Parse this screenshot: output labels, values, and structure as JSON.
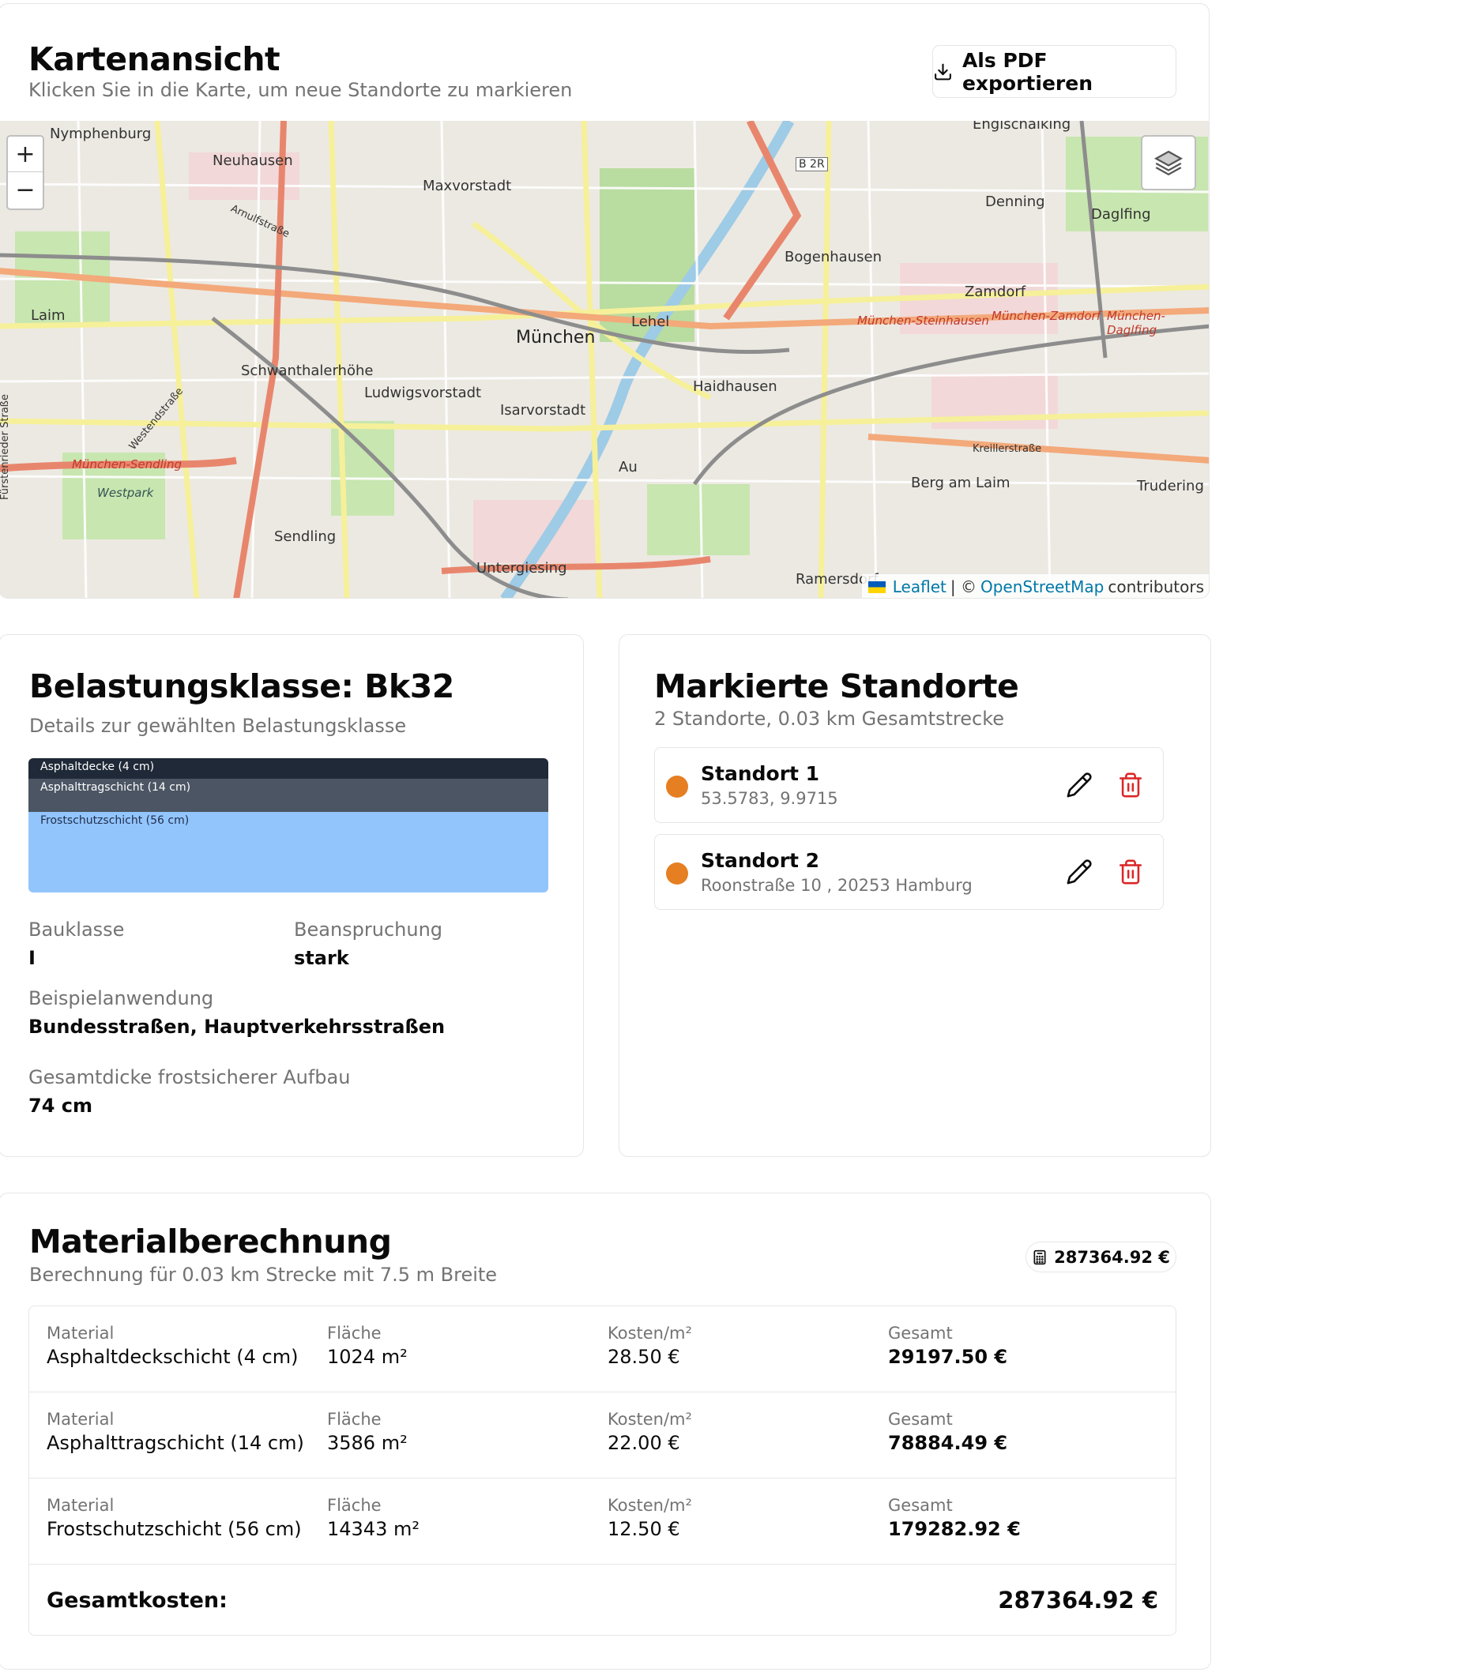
{
  "map_card": {
    "title": "Kartenansicht",
    "subtitle": "Klicken Sie in die Karte, um neue Standorte zu markieren",
    "export_button": "Als PDF exportieren",
    "zoom_in": "+",
    "zoom_out": "−",
    "attribution": {
      "leaflet": "Leaflet",
      "separator": "| ©",
      "osm": "OpenStreetMap",
      "suffix": "contributors"
    },
    "labels": [
      "Nymphenburg",
      "Neuhausen",
      "Maxvorstadt",
      "Englschalking",
      "B 2R",
      "Denning",
      "Daglfing",
      "Bogenhausen",
      "Zamdorf",
      "Laim",
      "München",
      "Lehel",
      "München-Steinhausen",
      "München-Zamdorf",
      "München-Daglfing",
      "Schwanthalerhöhe",
      "Ludwigsvorstadt",
      "Isarvorstadt",
      "Haidhausen",
      "München-Sendling",
      "Westpark",
      "Au",
      "Berg am Laim",
      "Trudering",
      "Sendling",
      "Untergiesing",
      "Ramersdorf",
      "Kreillerstraße",
      "Westendstraße",
      "Arnulfstraße",
      "Fürstenrieder Straße"
    ]
  },
  "bk_card": {
    "title": "Belastungsklasse: Bk32",
    "subtitle": "Details zur gewählten Belastungsklasse",
    "layers": [
      {
        "label": "Asphaltdecke (4 cm)",
        "thickness_cm": 4,
        "color": "#1f2937"
      },
      {
        "label": "Asphalttragschicht (14 cm)",
        "thickness_cm": 14,
        "color": "#4b5563"
      },
      {
        "label": "Frostschutzschicht (56 cm)",
        "thickness_cm": 56,
        "color": "#93c5fd"
      }
    ],
    "bauklasse_label": "Bauklasse",
    "bauklasse_value": "I",
    "beanspruchung_label": "Beanspruchung",
    "beanspruchung_value": "stark",
    "beispiel_label": "Beispielanwendung",
    "beispiel_value": "Bundesstraßen, Hauptverkehrsstraßen",
    "gesamtdicke_label": "Gesamtdicke frostsicherer Aufbau",
    "gesamtdicke_value": "74 cm"
  },
  "standorte_card": {
    "title": "Markierte Standorte",
    "subtitle": "2 Standorte, 0.03 km Gesamtstrecke",
    "items": [
      {
        "name": "Standort 1",
        "address": "53.5783, 9.9715"
      },
      {
        "name": "Standort 2",
        "address": "Roonstraße 10 , 20253 Hamburg"
      }
    ],
    "marker_color": "#e67e22",
    "delete_color": "#dc2626"
  },
  "material_card": {
    "title": "Materialberechnung",
    "subtitle": "Berechnung für 0.03 km Strecke mit 7.5 m Breite",
    "badge": "287364.92 €",
    "headers": {
      "material": "Material",
      "flaeche": "Fläche",
      "kosten": "Kosten/m²",
      "gesamt": "Gesamt"
    },
    "rows": [
      {
        "material": "Asphaltdeckschicht (4 cm)",
        "flaeche": "1024 m²",
        "kosten": "28.50 €",
        "gesamt": "29197.50 €"
      },
      {
        "material": "Asphalttragschicht (14 cm)",
        "flaeche": "3586 m²",
        "kosten": "22.00 €",
        "gesamt": "78884.49 €"
      },
      {
        "material": "Frostschutzschicht (56 cm)",
        "flaeche": "14343 m²",
        "kosten": "12.50 €",
        "gesamt": "179282.92 €"
      }
    ],
    "total_label": "Gesamtkosten:",
    "total_value": "287364.92 €"
  }
}
